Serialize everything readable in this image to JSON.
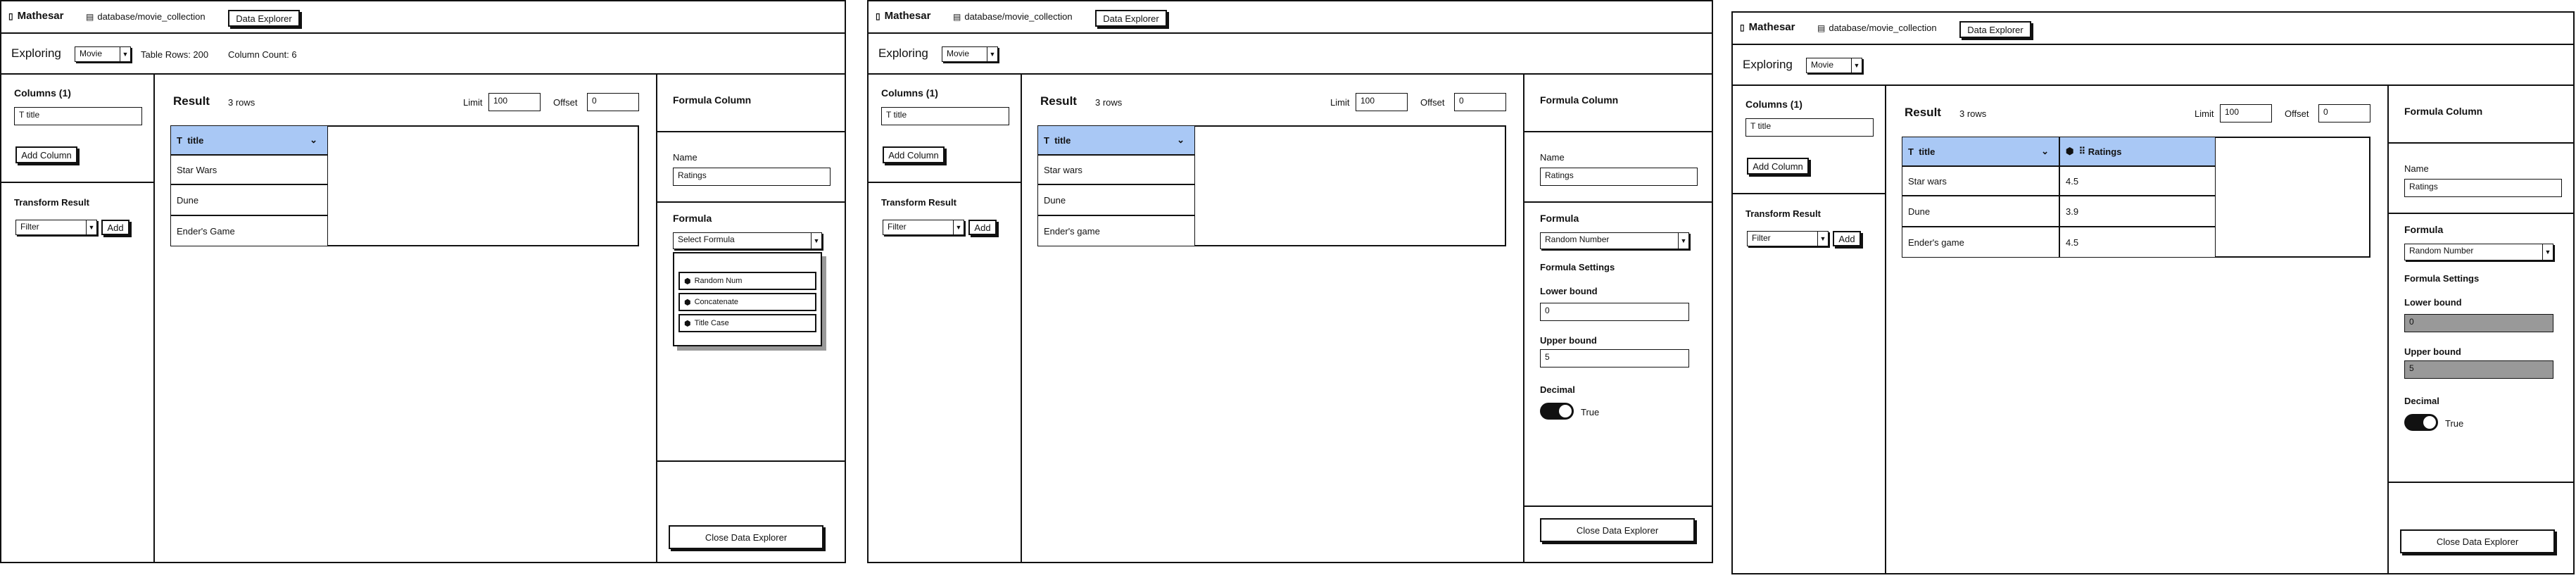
{
  "app": {
    "name": "Mathesar",
    "db_path": "database/movie_collection",
    "explorer_tab": "Data Explorer"
  },
  "explore": {
    "label": "Exploring",
    "table": "Movie",
    "table_rows": "Table Rows: 200",
    "column_count": "Column Count: 6"
  },
  "sidebar": {
    "columns_title": "Columns (1)",
    "column_chip": "title",
    "add_column": "Add Column",
    "transform_title": "Transform Result",
    "filter": "Filter",
    "add": "Add"
  },
  "result": {
    "title": "Result",
    "rows": "3 rows",
    "limit_label": "Limit",
    "limit_value": "100",
    "offset_label": "Offset",
    "offset_value": "0"
  },
  "panel": {
    "title": "Formula Column",
    "name_label": "Name",
    "name_value": "Ratings",
    "formula_label": "Formula",
    "select_placeholder": "Select Formula",
    "selected": "Random Number",
    "options": [
      "Random Num",
      "Concatenate",
      "Title Case"
    ],
    "settings_title": "Formula Settings",
    "lower_label": "Lower bound",
    "lower_value": "0",
    "upper_label": "Upper bound",
    "upper_value": "5",
    "decimal_label": "Decimal",
    "decimal_value": "True",
    "close": "Close Data Explorer"
  },
  "tables": {
    "t1": {
      "col": "title",
      "rows": [
        "Star Wars",
        "Dune",
        "Ender's Game"
      ]
    },
    "t2": {
      "col": "title",
      "rows": [
        "Star wars",
        "Dune",
        "Ender's game"
      ]
    },
    "t3": {
      "col1": "title",
      "col2": "Ratings",
      "rows": [
        [
          "Star wars",
          "4.5"
        ],
        [
          "Dune",
          "3.9"
        ],
        [
          "Ender's game",
          "4.5"
        ]
      ]
    }
  },
  "colors": {
    "header_blue": "#a9c8f5",
    "border": "#111111",
    "disabled_input": "#999999"
  }
}
